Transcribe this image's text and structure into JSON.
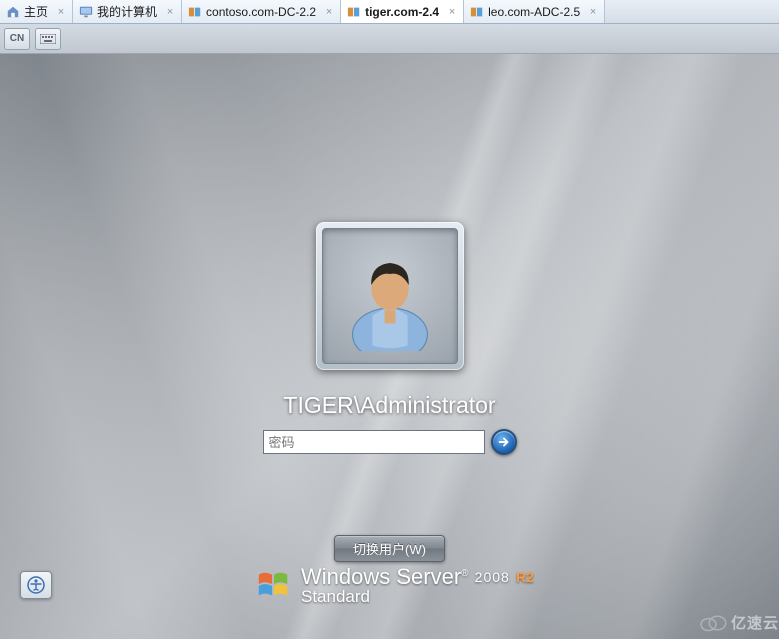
{
  "tabs": [
    {
      "label": "主页",
      "icon": "home"
    },
    {
      "label": "我的计算机",
      "icon": "monitor"
    },
    {
      "label": "contoso.com-DC-2.2",
      "icon": "vm"
    },
    {
      "label": "tiger.com-2.4",
      "icon": "vm",
      "active": true
    },
    {
      "label": "leo.com-ADC-2.5",
      "icon": "vm"
    }
  ],
  "toolbar": {
    "b1": "CN",
    "b2": "kbd"
  },
  "login": {
    "username": "TIGER\\Administrator",
    "password_placeholder": "密码",
    "switch_user_label": "切换用户(W)"
  },
  "brand": {
    "line1a": "Windows Server",
    "year": "2008",
    "r2": "R2",
    "line2": "Standard"
  },
  "watermark": "亿速云"
}
